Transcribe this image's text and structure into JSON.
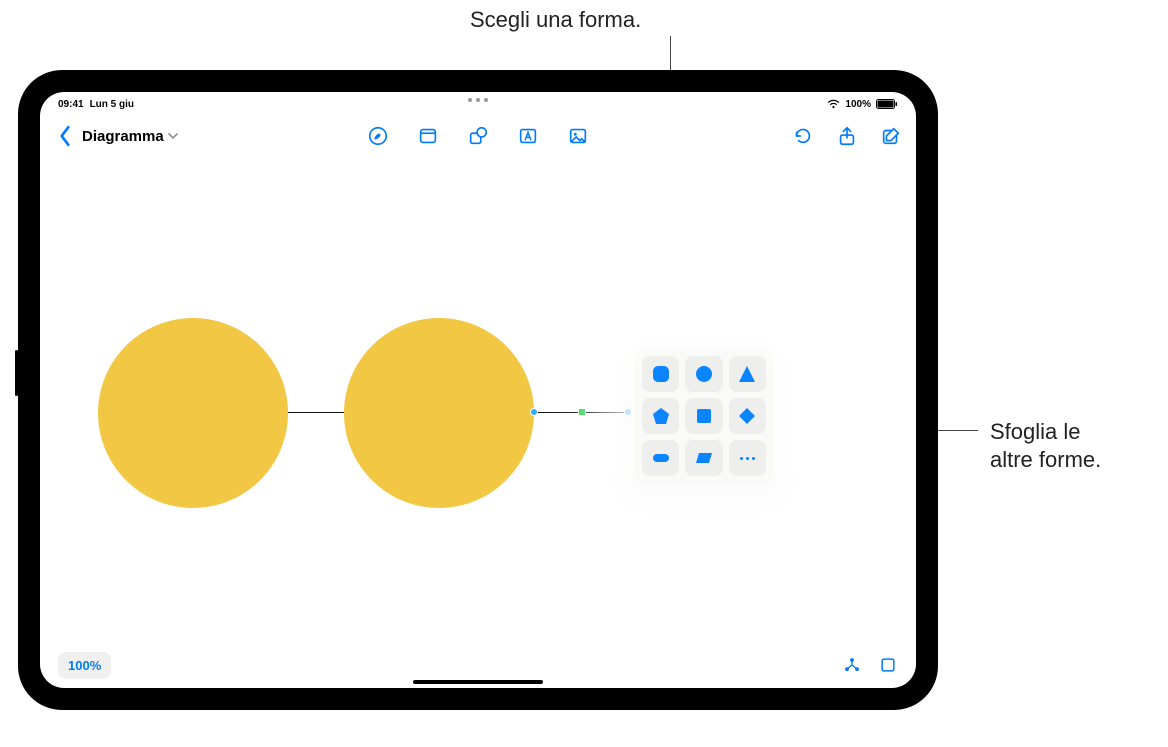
{
  "callouts": {
    "top": "Scegli una forma.",
    "right_line1": "Sfoglia le",
    "right_line2": "altre forme."
  },
  "status": {
    "time": "09:41",
    "date": "Lun 5 giu",
    "battery_pct": "100%"
  },
  "doc": {
    "title": "Diagramma"
  },
  "toolbar": {
    "center": [
      "drawing-tool",
      "sticky-note-tool",
      "shapes-tool",
      "textbox-tool",
      "media-tool"
    ],
    "right": [
      "undo",
      "share",
      "compose"
    ]
  },
  "shape_picker": {
    "shapes": [
      "rounded-square",
      "circle",
      "triangle",
      "pentagon",
      "square",
      "diamond",
      "pill",
      "parallelogram",
      "more"
    ]
  },
  "bottom": {
    "zoom": "100%"
  },
  "colors": {
    "accent": "#007aff",
    "shape_fill": "#f2c744",
    "picker_icon": "#0a84ff"
  }
}
